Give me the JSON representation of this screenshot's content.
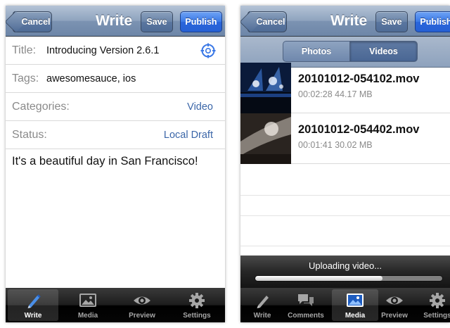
{
  "left": {
    "nav": {
      "cancel": "Cancel",
      "title": "Write",
      "save": "Save",
      "publish": "Publish"
    },
    "fields": {
      "title_label": "Title:",
      "title_value": "Introducing Version 2.6.1",
      "tags_label": "Tags:",
      "tags_value": "awesomesauce, ios",
      "categories_label": "Categories:",
      "categories_value": "Video",
      "status_label": "Status:",
      "status_value": "Local Draft"
    },
    "body": "It's a beautiful day in San Francisco!",
    "tabs": [
      {
        "label": "Write",
        "icon": "pencil-icon",
        "active": true
      },
      {
        "label": "Media",
        "icon": "image-icon",
        "active": false
      },
      {
        "label": "Preview",
        "icon": "eye-icon",
        "active": false
      },
      {
        "label": "Settings",
        "icon": "gear-icon",
        "active": false
      }
    ]
  },
  "right": {
    "nav": {
      "cancel": "Cancel",
      "title": "Write",
      "save": "Save",
      "publish": "Publish"
    },
    "segments": [
      "Photos",
      "Videos"
    ],
    "selected_segment": "Videos",
    "media": [
      {
        "name": "20101012-054102.mov",
        "meta": "00:02:28 44.17 MB"
      },
      {
        "name": "20101012-054402.mov",
        "meta": "00:01:41 30.02 MB"
      }
    ],
    "upload": {
      "text": "Uploading video...",
      "progress": 0.68
    },
    "tabs": [
      {
        "label": "Write",
        "icon": "pencil-icon",
        "active": false
      },
      {
        "label": "Comments",
        "icon": "comments-icon",
        "active": false
      },
      {
        "label": "Media",
        "icon": "image-icon",
        "active": true
      },
      {
        "label": "Preview",
        "icon": "eye-icon",
        "active": false
      },
      {
        "label": "Settings",
        "icon": "gear-icon",
        "active": false
      }
    ]
  },
  "colors": {
    "accent_blue": "#2a66dc",
    "link_blue": "#3b66a8",
    "nav_bar": "#7c93b2"
  }
}
